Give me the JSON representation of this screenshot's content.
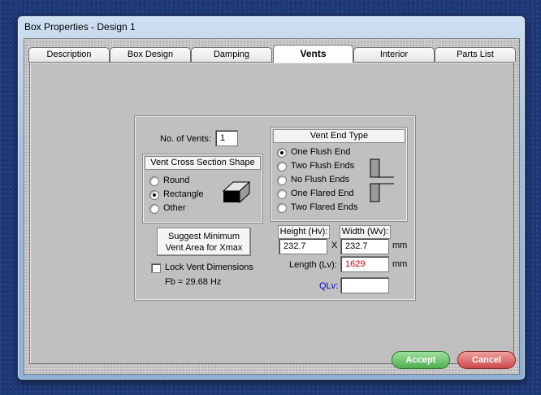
{
  "window": {
    "title": "Box Properties - Design 1"
  },
  "tabs": [
    {
      "label": "Description"
    },
    {
      "label": "Box Design"
    },
    {
      "label": "Damping"
    },
    {
      "label": "Vents",
      "active": true
    },
    {
      "label": "Interior"
    },
    {
      "label": "Parts List"
    }
  ],
  "vents": {
    "count_label": "No. of Vents:",
    "count_value": "1",
    "cross_section": {
      "title": "Vent Cross Section Shape",
      "options": [
        "Round",
        "Rectangle",
        "Other"
      ],
      "selected": "Rectangle"
    },
    "end_type": {
      "title": "Vent End Type",
      "options": [
        "One Flush End",
        "Two Flush Ends",
        "No Flush Ends",
        "One Flared End",
        "Two Flared Ends"
      ],
      "selected": "One Flush End"
    },
    "suggest_button": {
      "line1": "Suggest Minimum",
      "line2": "Vent Area for Xmax"
    },
    "lock_label": "Lock Vent Dimensions",
    "lock_checked": false,
    "fb_text": "Fb = 29.68 Hz",
    "height_label": "Height (Hv):",
    "height_value": "232.7",
    "times": "X",
    "width_label": "Width (Wv):",
    "width_value": "232.7",
    "unit_mm": "mm",
    "length_label": "Length (Lv):",
    "length_value": "1629",
    "qlv_label": "QLv:",
    "qlv_value": ""
  },
  "footer": {
    "accept_label": "Accept",
    "cancel_label": "Cancel"
  },
  "colors": {
    "length_value": "#cc0000",
    "qlv_label": "#0000cc",
    "accept": "#4fae4f",
    "cancel": "#c94a4a"
  },
  "icons": [
    "rectangle-vent-icon",
    "flush-end-vent-icon"
  ]
}
